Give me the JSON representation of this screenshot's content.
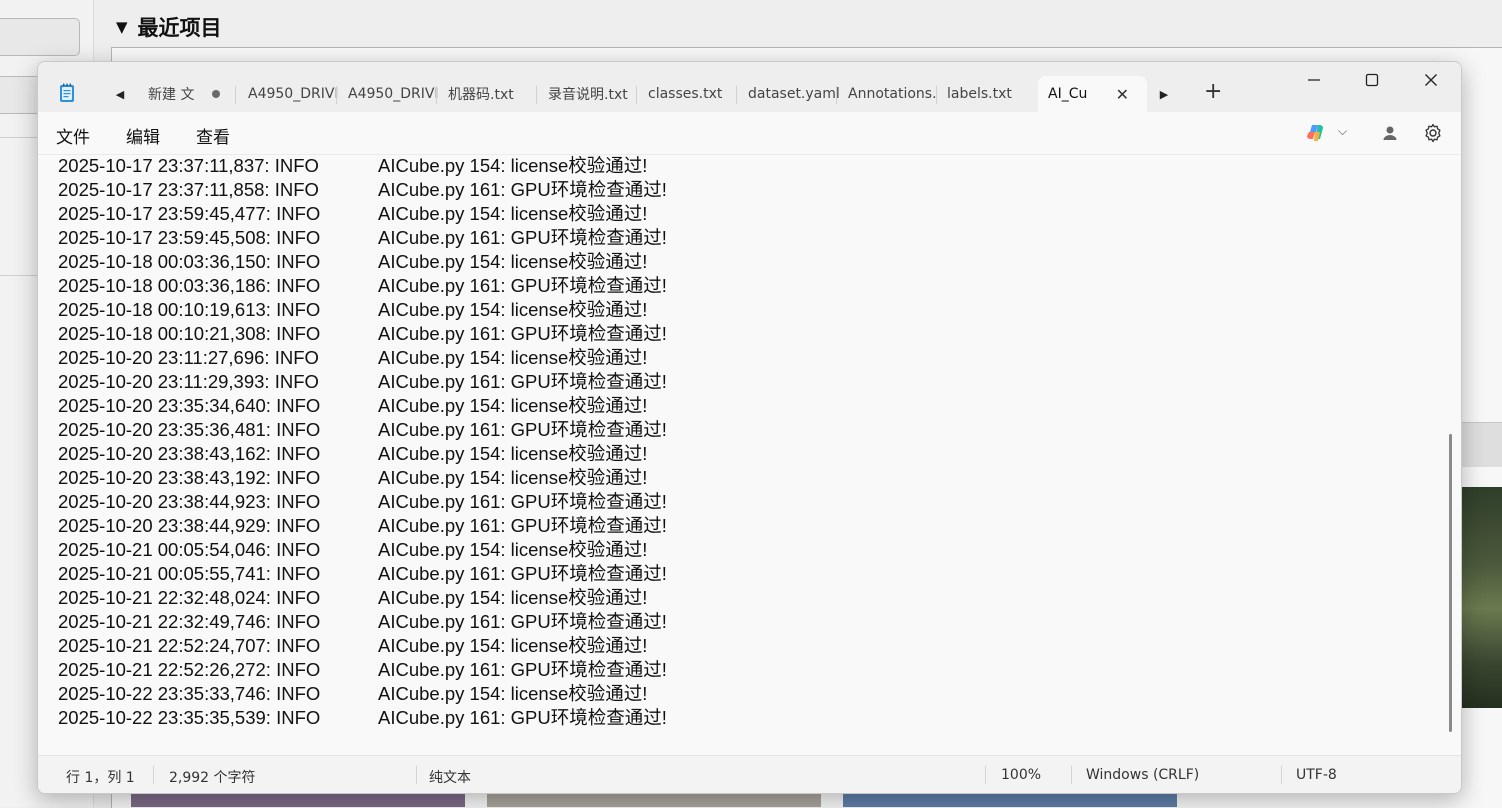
{
  "background": {
    "header_title": "最近项目"
  },
  "window": {
    "tabs": [
      {
        "label": "新建 文",
        "modified": true
      },
      {
        "label": "A4950_DRIVI"
      },
      {
        "label": "A4950_DRIVI"
      },
      {
        "label": "机器码.txt"
      },
      {
        "label": "录音说明.txt"
      },
      {
        "label": "classes.txt"
      },
      {
        "label": "dataset.yaml"
      },
      {
        "label": "Annotations."
      },
      {
        "label": "labels.txt"
      },
      {
        "label": "AI_Cu",
        "active": true
      }
    ],
    "menu": {
      "file": "文件",
      "edit": "编辑",
      "view": "查看"
    },
    "icons": {
      "app": "notepad-icon",
      "tab_prev": "chevron-left-icon",
      "tab_next": "chevron-right-icon",
      "add": "plus-icon",
      "minimize": "minimize-icon",
      "maximize": "maximize-icon",
      "close": "close-icon",
      "copilot": "copilot-icon",
      "account": "user-icon",
      "settings": "gear-icon"
    },
    "accent_color": "#0067c0"
  },
  "log": {
    "lines": [
      {
        "ts": "2025-10-17 23:37:11,837: INFO",
        "msg": "AICube.py 154: license校验通过!"
      },
      {
        "ts": "2025-10-17 23:37:11,858: INFO",
        "msg": "AICube.py 161: GPU环境检查通过!"
      },
      {
        "ts": "2025-10-17 23:59:45,477: INFO",
        "msg": "AICube.py 154: license校验通过!"
      },
      {
        "ts": "2025-10-17 23:59:45,508: INFO",
        "msg": "AICube.py 161: GPU环境检查通过!"
      },
      {
        "ts": "2025-10-18 00:03:36,150: INFO",
        "msg": "AICube.py 154: license校验通过!"
      },
      {
        "ts": "2025-10-18 00:03:36,186: INFO",
        "msg": "AICube.py 161: GPU环境检查通过!"
      },
      {
        "ts": "2025-10-18 00:10:19,613: INFO",
        "msg": "AICube.py 154: license校验通过!"
      },
      {
        "ts": "2025-10-18 00:10:21,308: INFO",
        "msg": "AICube.py 161: GPU环境检查通过!"
      },
      {
        "ts": "2025-10-20 23:11:27,696: INFO",
        "msg": "AICube.py 154: license校验通过!"
      },
      {
        "ts": "2025-10-20 23:11:29,393: INFO",
        "msg": "AICube.py 161: GPU环境检查通过!"
      },
      {
        "ts": "2025-10-20 23:35:34,640: INFO",
        "msg": "AICube.py 154: license校验通过!"
      },
      {
        "ts": "2025-10-20 23:35:36,481: INFO",
        "msg": "AICube.py 161: GPU环境检查通过!"
      },
      {
        "ts": "2025-10-20 23:38:43,162: INFO",
        "msg": "AICube.py 154: license校验通过!"
      },
      {
        "ts": "2025-10-20 23:38:43,192: INFO",
        "msg": "AICube.py 154: license校验通过!"
      },
      {
        "ts": "2025-10-20 23:38:44,923: INFO",
        "msg": "AICube.py 161: GPU环境检查通过!"
      },
      {
        "ts": "2025-10-20 23:38:44,929: INFO",
        "msg": "AICube.py 161: GPU环境检查通过!"
      },
      {
        "ts": "2025-10-21 00:05:54,046: INFO",
        "msg": "AICube.py 154: license校验通过!"
      },
      {
        "ts": "2025-10-21 00:05:55,741: INFO",
        "msg": "AICube.py 161: GPU环境检查通过!"
      },
      {
        "ts": "2025-10-21 22:32:48,024: INFO",
        "msg": "AICube.py 154: license校验通过!"
      },
      {
        "ts": "2025-10-21 22:32:49,746: INFO",
        "msg": "AICube.py 161: GPU环境检查通过!"
      },
      {
        "ts": "2025-10-21 22:52:24,707: INFO",
        "msg": "AICube.py 154: license校验通过!"
      },
      {
        "ts": "2025-10-21 22:52:26,272: INFO",
        "msg": "AICube.py 161: GPU环境检查通过!"
      },
      {
        "ts": "2025-10-22 23:35:33,746: INFO",
        "msg": "AICube.py 154: license校验通过!"
      },
      {
        "ts": "2025-10-22 23:35:35,539: INFO",
        "msg": "AICube.py 161: GPU环境检查通过!"
      }
    ]
  },
  "status": {
    "position": "行 1，列 1",
    "char_count": "2,992 个字符",
    "format": "纯文本",
    "zoom": "100%",
    "line_ending": "Windows (CRLF)",
    "encoding": "UTF-8"
  }
}
